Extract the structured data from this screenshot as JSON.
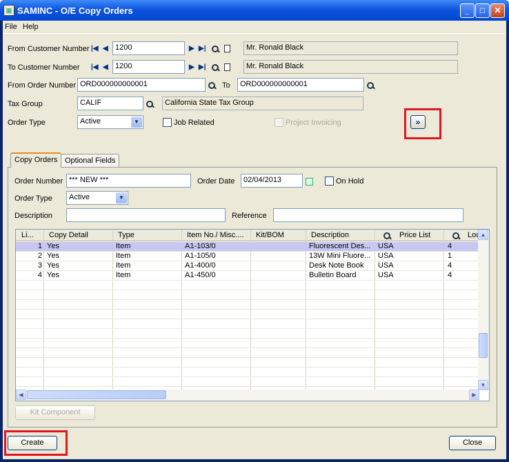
{
  "window": {
    "title": "SAMINC - O/E Copy Orders"
  },
  "menu": {
    "file": "File",
    "help": "Help"
  },
  "header": {
    "from_customer_label": "From Customer Number",
    "from_customer_value": "1200",
    "from_customer_name": "Mr. Ronald Black",
    "to_customer_label": "To Customer Number",
    "to_customer_value": "1200",
    "to_customer_name": "Mr. Ronald Black",
    "from_order_label": "From Order Number",
    "from_order_value": "ORD000000000001",
    "to_label": "To",
    "to_order_value": "ORD000000000001",
    "tax_group_label": "Tax Group",
    "tax_group_value": "CALIF",
    "tax_group_desc": "California State Tax Group",
    "order_type_label": "Order Type",
    "order_type_value": "Active",
    "job_related_label": "Job Related",
    "project_invoicing_label": "Project Invoicing"
  },
  "tabs": [
    {
      "label": "Copy Orders"
    },
    {
      "label": "Optional Fields"
    }
  ],
  "copy": {
    "order_number_label": "Order Number",
    "order_number_value": "*** NEW ***",
    "order_date_label": "Order Date",
    "order_date_value": "02/04/2013",
    "on_hold_label": "On Hold",
    "order_type_label": "Order Type",
    "order_type_value": "Active",
    "description_label": "Description",
    "description_value": "",
    "reference_label": "Reference",
    "reference_value": ""
  },
  "grid": {
    "columns": [
      "Li...",
      "Copy Detail",
      "Type",
      "Item No./ Misc....",
      "Kit/BOM",
      "Description",
      "Price List",
      "Loc"
    ],
    "rows": [
      {
        "line": "1",
        "copy": "Yes",
        "type": "Item",
        "item": "A1-103/0",
        "kit": "",
        "desc": "Fluorescent Des...",
        "price": "USA",
        "loc": "4"
      },
      {
        "line": "2",
        "copy": "Yes",
        "type": "Item",
        "item": "A1-105/0",
        "kit": "",
        "desc": "13W Mini Fluore...",
        "price": "USA",
        "loc": "1"
      },
      {
        "line": "3",
        "copy": "Yes",
        "type": "Item",
        "item": "A1-400/0",
        "kit": "",
        "desc": "Desk Note Book",
        "price": "USA",
        "loc": "4"
      },
      {
        "line": "4",
        "copy": "Yes",
        "type": "Item",
        "item": "A1-450/0",
        "kit": "",
        "desc": "Bulletin Board",
        "price": "USA",
        "loc": "4"
      }
    ]
  },
  "buttons": {
    "kit_component": "Kit Component",
    "create": "Create",
    "close": "Close",
    "next": "»"
  },
  "colors": {
    "highlight": "#e0161e",
    "selected_row": "#c7c7f2"
  }
}
